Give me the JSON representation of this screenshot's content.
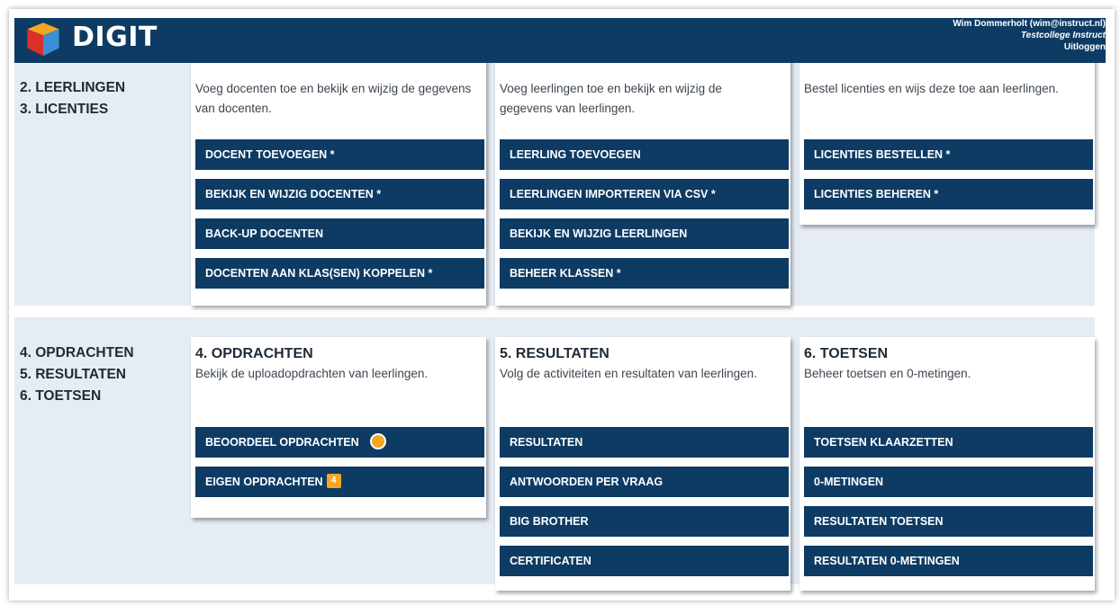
{
  "header": {
    "logo_text": "DIGIT",
    "user": "Wim Dommerholt (wim@instruct.nl)",
    "school": "Testcollege Instruct",
    "logout": "Uitloggen",
    "colors": {
      "bar": "#0e3b63",
      "accent": "#f5a623"
    }
  },
  "section1": {
    "side_items": [
      "2. LEERLINGEN",
      "3. LICENTIES"
    ],
    "cards": [
      {
        "description": "Voeg docenten toe en bekijk en wijzig de gegevens van docenten.",
        "buttons": [
          "DOCENT TOEVOEGEN *",
          "BEKIJK EN WIJZIG DOCENTEN *",
          "BACK-UP DOCENTEN",
          "DOCENTEN AAN KLAS(SEN) KOPPELEN *"
        ]
      },
      {
        "description": "Voeg leerlingen toe en bekijk en wijzig de gegevens van leerlingen.",
        "buttons": [
          "LEERLING TOEVOEGEN",
          "LEERLINGEN IMPORTEREN VIA CSV *",
          "BEKIJK EN WIJZIG LEERLINGEN",
          "BEHEER KLASSEN *"
        ]
      },
      {
        "description": "Bestel licenties en wijs deze toe aan leerlingen.",
        "buttons": [
          "LICENTIES BESTELLEN *",
          "LICENTIES BEHEREN *"
        ]
      }
    ]
  },
  "section2": {
    "side_items": [
      "4. OPDRACHTEN",
      "5. RESULTATEN",
      "6. TOETSEN"
    ],
    "cards": [
      {
        "title": "4. OPDRACHTEN",
        "description": "Bekijk de uploadopdrachten van leerlingen.",
        "buttons": [
          "BEOORDEEL OPDRACHTEN",
          "EIGEN OPDRACHTEN"
        ],
        "badge_count": "4"
      },
      {
        "title": "5. RESULTATEN",
        "description": "Volg de activiteiten en resultaten van leerlingen.",
        "buttons": [
          "RESULTATEN",
          "ANTWOORDEN PER VRAAG",
          "BIG BROTHER",
          "CERTIFICATEN"
        ]
      },
      {
        "title": "6. TOETSEN",
        "description": "Beheer toetsen en 0-metingen.",
        "buttons": [
          "TOETSEN KLAARZETTEN",
          "0-METINGEN",
          "RESULTATEN TOETSEN",
          "RESULTATEN 0-METINGEN"
        ]
      }
    ]
  }
}
